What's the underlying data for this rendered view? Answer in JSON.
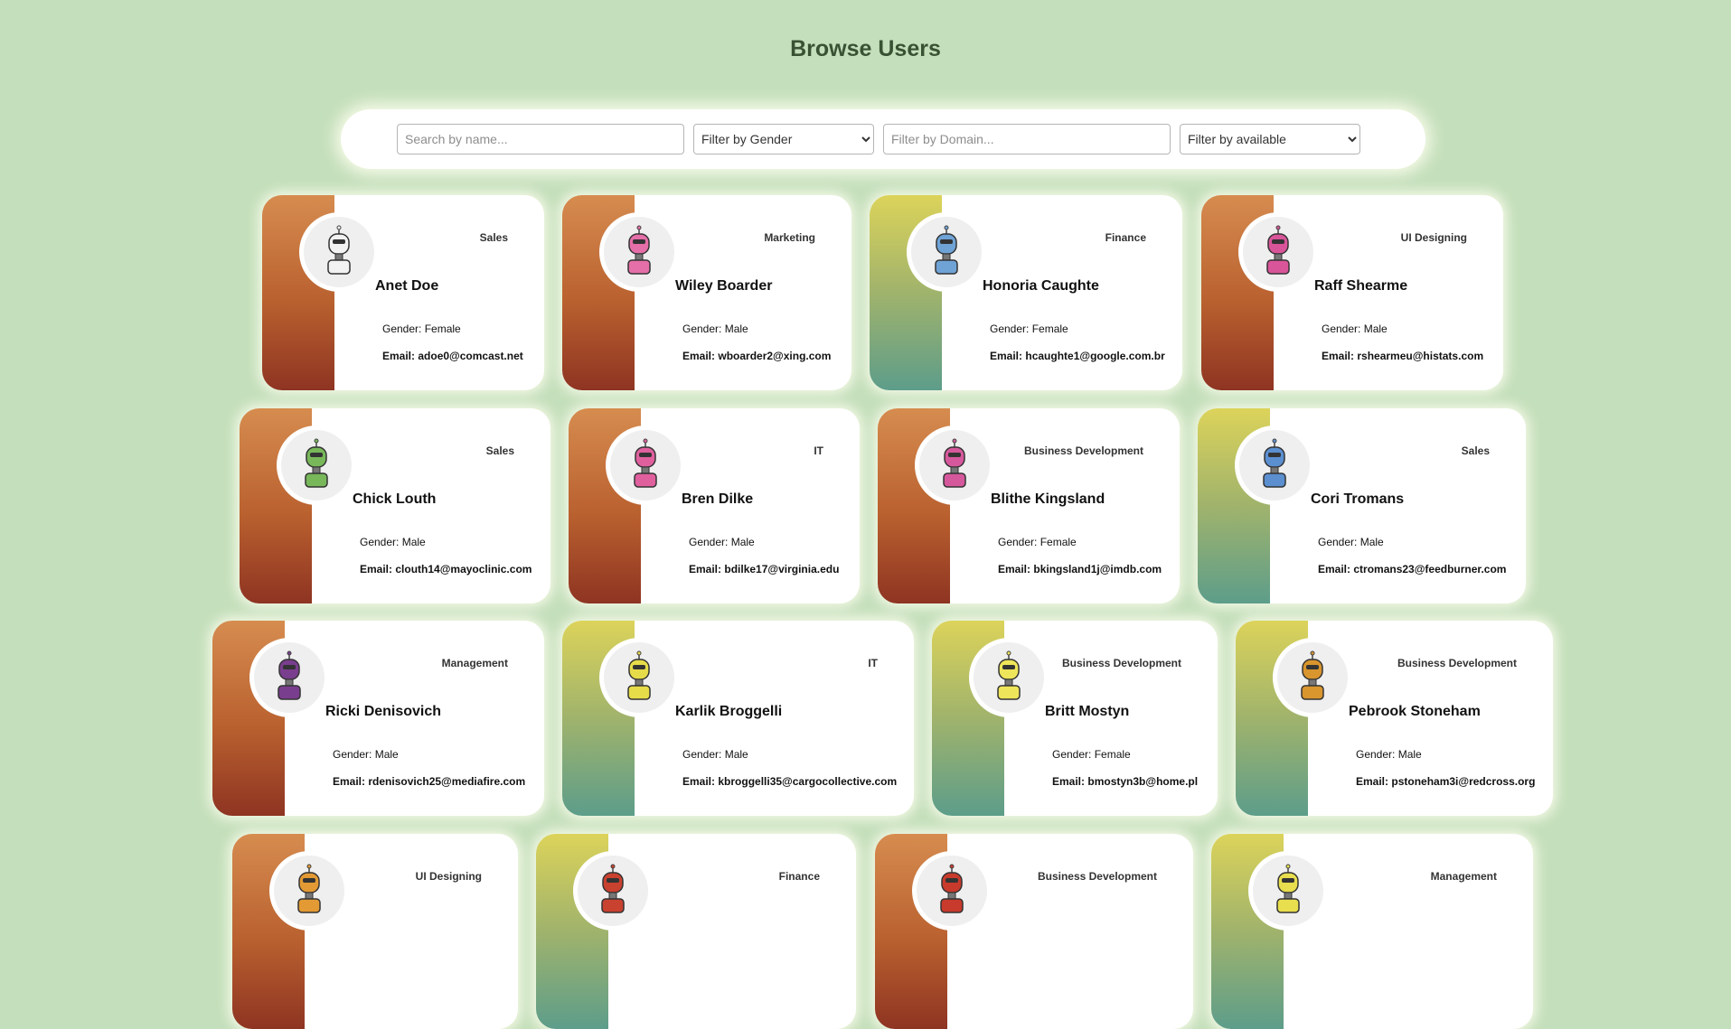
{
  "page": {
    "title": "Browse Users"
  },
  "filters": {
    "name_placeholder": "Search by name...",
    "gender_selected": "Filter by Gender",
    "domain_placeholder": "Filter by Domain...",
    "available_selected": "Filter by available"
  },
  "labels": {
    "gender_prefix": "Gender: ",
    "email_prefix": "Email: "
  },
  "colors": {
    "background": "#c4dfbb",
    "title": "#385233",
    "strip_orange": "#b9602f",
    "strip_teal": "#a0b36c"
  },
  "users": [
    {
      "name": "Anet Doe",
      "domain": "Sales",
      "gender": "Female",
      "email": "adoe0@comcast.net",
      "strip": "orange",
      "avatar_color": "#f2f2f2",
      "avatar_icon": "robot-avatar-icon"
    },
    {
      "name": "Wiley Boarder",
      "domain": "Marketing",
      "gender": "Male",
      "email": "wboarder2@xing.com",
      "strip": "orange",
      "avatar_color": "#e56fa8",
      "avatar_icon": "robot-avatar-icon"
    },
    {
      "name": "Honoria Caughte",
      "domain": "Finance",
      "gender": "Female",
      "email": "hcaughte1@google.com.br",
      "strip": "teal",
      "avatar_color": "#6fa3d6",
      "avatar_icon": "robot-avatar-icon"
    },
    {
      "name": "Raff Shearme",
      "domain": "UI Designing",
      "gender": "Male",
      "email": "rshearmeu@histats.com",
      "strip": "orange",
      "avatar_color": "#d9559a",
      "avatar_icon": "robot-avatar-icon"
    },
    {
      "name": "Chick Louth",
      "domain": "Sales",
      "gender": "Male",
      "email": "clouth14@mayoclinic.com",
      "strip": "orange",
      "avatar_color": "#78b85a",
      "avatar_icon": "robot-avatar-icon"
    },
    {
      "name": "Bren Dilke",
      "domain": "IT",
      "gender": "Male",
      "email": "bdilke17@virginia.edu",
      "strip": "orange",
      "avatar_color": "#e0609e",
      "avatar_icon": "robot-avatar-icon"
    },
    {
      "name": "Blithe Kingsland",
      "domain": "Business Development",
      "gender": "Female",
      "email": "bkingsland1j@imdb.com",
      "strip": "orange",
      "avatar_color": "#d6589c",
      "avatar_icon": "robot-avatar-icon"
    },
    {
      "name": "Cori Tromans",
      "domain": "Sales",
      "gender": "Male",
      "email": "ctromans23@feedburner.com",
      "strip": "teal",
      "avatar_color": "#5b8fd0",
      "avatar_icon": "robot-avatar-icon"
    },
    {
      "name": "Ricki Denisovich",
      "domain": "Management",
      "gender": "Male",
      "email": "rdenisovich25@mediafire.com",
      "strip": "orange",
      "avatar_color": "#7a3e8e",
      "avatar_icon": "robot-avatar-icon"
    },
    {
      "name": "Karlik Broggelli",
      "domain": "IT",
      "gender": "Male",
      "email": "kbroggelli35@cargocollective.com",
      "strip": "teal",
      "avatar_color": "#e6dc4a",
      "avatar_icon": "robot-avatar-icon"
    },
    {
      "name": "Britt Mostyn",
      "domain": "Business Development",
      "gender": "Female",
      "email": "bmostyn3b@home.pl",
      "strip": "teal",
      "avatar_color": "#efe55a",
      "avatar_icon": "robot-avatar-icon"
    },
    {
      "name": "Pebrook Stoneham",
      "domain": "Business Development",
      "gender": "Male",
      "email": "pstoneham3i@redcross.org",
      "strip": "teal",
      "avatar_color": "#d9952e",
      "avatar_icon": "robot-avatar-icon"
    },
    {
      "name": "",
      "domain": "UI Designing",
      "gender": "",
      "email": "",
      "strip": "orange",
      "avatar_color": "#e39a34",
      "avatar_icon": "robot-avatar-icon"
    },
    {
      "name": "",
      "domain": "Finance",
      "gender": "",
      "email": "",
      "strip": "teal",
      "avatar_color": "#c9412f",
      "avatar_icon": "robot-avatar-icon"
    },
    {
      "name": "",
      "domain": "Business Development",
      "gender": "",
      "email": "",
      "strip": "orange",
      "avatar_color": "#c83a2c",
      "avatar_icon": "robot-avatar-icon"
    },
    {
      "name": "",
      "domain": "Management",
      "gender": "",
      "email": "",
      "strip": "teal",
      "avatar_color": "#e8de4e",
      "avatar_icon": "robot-avatar-icon"
    }
  ]
}
